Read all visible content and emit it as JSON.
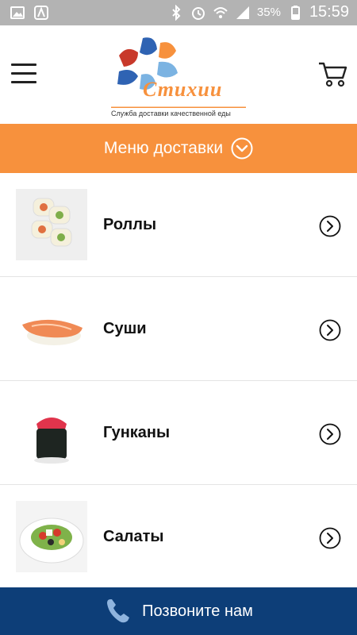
{
  "status_bar": {
    "battery": "35%",
    "time": "15:59"
  },
  "header": {
    "brand": "Стихии",
    "tagline": "Служба доставки качественной еды"
  },
  "menu_bar": {
    "label": "Меню доставки"
  },
  "categories": [
    {
      "label": "Роллы"
    },
    {
      "label": "Суши"
    },
    {
      "label": "Гунканы"
    },
    {
      "label": "Салаты"
    }
  ],
  "call_bar": {
    "label": "Позвоните нам"
  },
  "colors": {
    "accent_orange": "#f7913d",
    "call_bar_blue": "#0d3e78",
    "status_bar_gray": "#b3b3b3"
  }
}
